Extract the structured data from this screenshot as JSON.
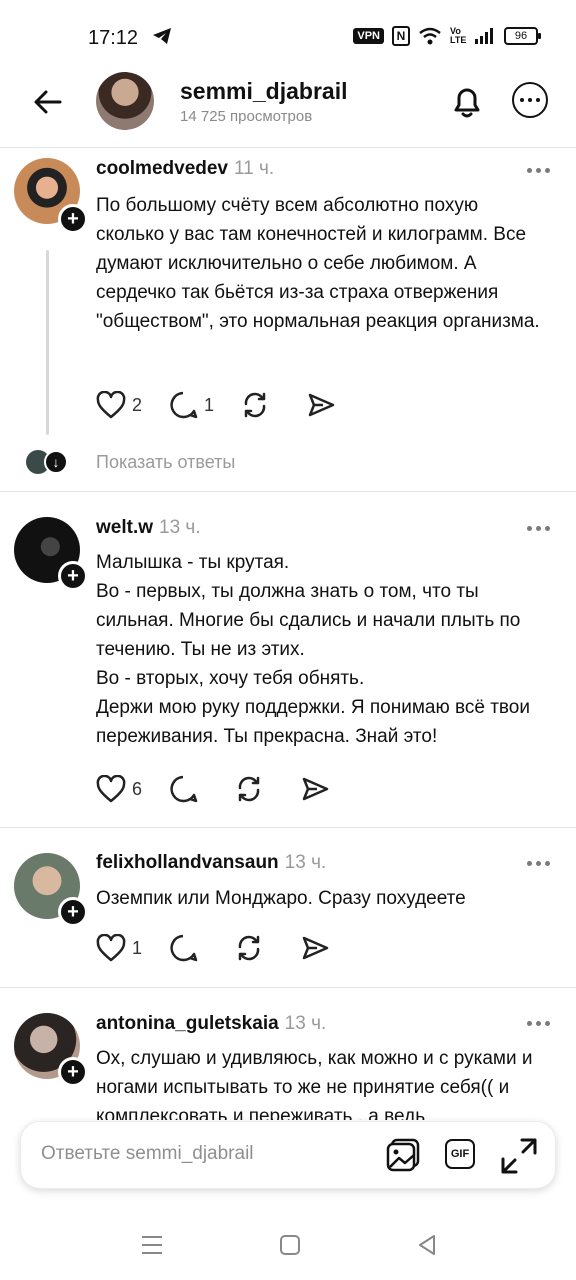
{
  "status_bar": {
    "time": "17:12",
    "vpn": "VPN",
    "nfc": "N",
    "volte": "Vo LTE",
    "battery": "96"
  },
  "header": {
    "username": "semmi_djabrail",
    "views": "14 725 просмотров"
  },
  "posts": [
    {
      "username": "coolmedvedev",
      "time": "11 ч.",
      "text": "По большому счёту всем абсолютно похую сколько у вас там конечностей и килограмм. Все думают исключительно о себе любимом. А сердечко так бьётся из-за страха отвержения \"обществом\", это нормальная реакция организма.",
      "likes": "2",
      "comments": "1",
      "show_replies": "Показать ответы"
    },
    {
      "username": "welt.w",
      "time": "13 ч.",
      "text": "Малышка - ты крутая.\nВо - первых, ты должна знать о том, что ты сильная. Многие бы сдались и начали плыть по течению. Ты не из этих.\nВо - вторых, хочу тебя обнять.\nДержи мою руку поддержки. Я понимаю всё твои переживания. Ты прекрасна. Знай это!",
      "likes": "6",
      "comments": ""
    },
    {
      "username": "felixhollandvansaun",
      "time": "13 ч.",
      "text": "Оземпик или Монджаро. Сразу похудеете",
      "likes": "1",
      "comments": ""
    },
    {
      "username": "antonina_guletskaia",
      "time": "13 ч.",
      "text": "Ох, слушаю и удивляюсь, как можно и с руками и ногами испытывать то же не принятие себя(( и комплексовать и переживать , а ведь"
    }
  ],
  "reply": {
    "placeholder": "Ответьте semmi_djabrail",
    "gif_label": "GIF"
  },
  "icons": [
    "back-arrow-icon",
    "bell-icon",
    "more-icon",
    "heart-icon",
    "comment-icon",
    "repost-icon",
    "share-icon",
    "image-icon",
    "gif-icon",
    "expand-icon"
  ]
}
